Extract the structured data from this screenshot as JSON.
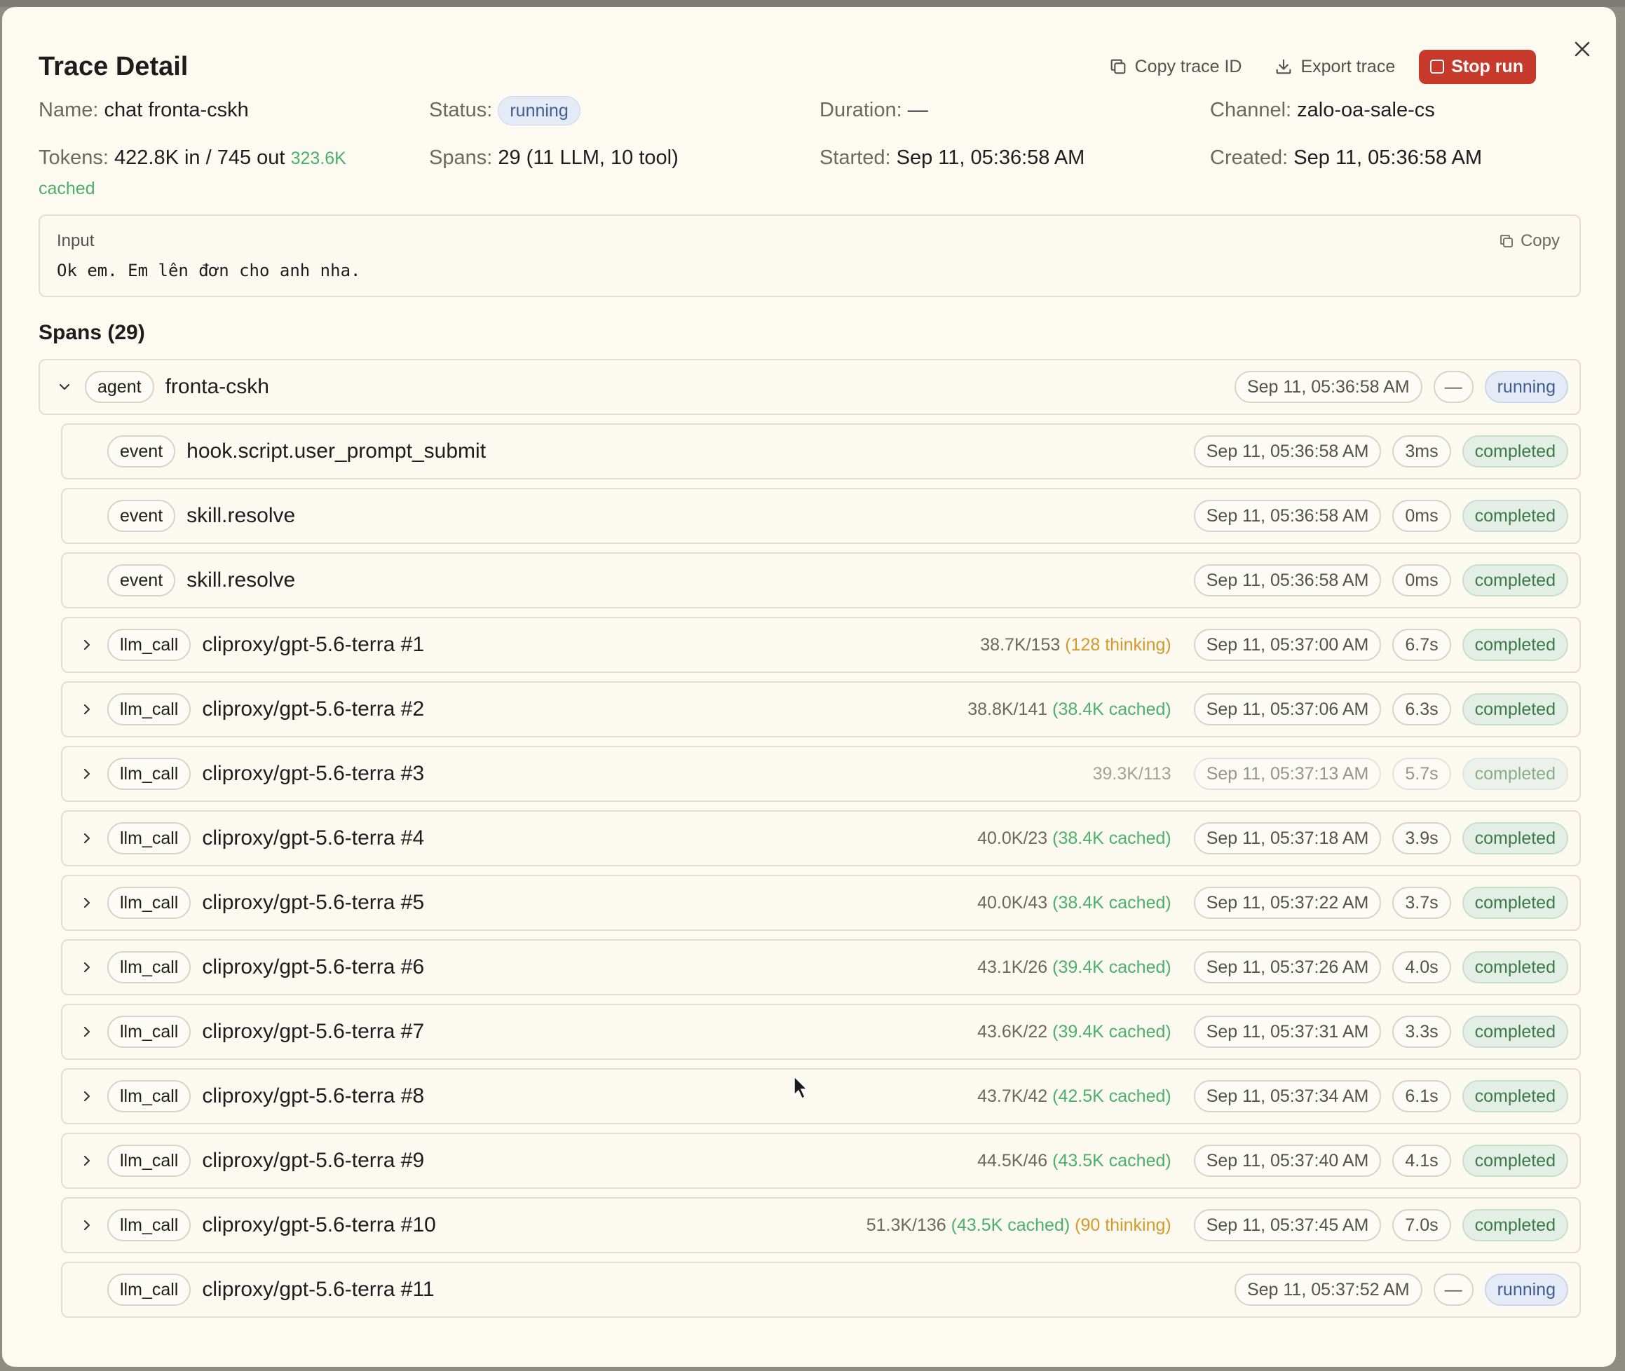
{
  "modal": {
    "title": "Trace Detail",
    "copy_trace_id": "Copy trace ID",
    "export_trace": "Export trace",
    "stop_run": "Stop run"
  },
  "meta": {
    "name_label": "Name:",
    "name_value": "chat fronta-cskh",
    "status_label": "Status:",
    "status_value": "running",
    "duration_label": "Duration:",
    "duration_value": "—",
    "channel_label": "Channel:",
    "channel_value": "zalo-oa-sale-cs",
    "tokens_label": "Tokens:",
    "tokens_value": "422.8K in / 745 out",
    "tokens_cached_num": "323.6K",
    "tokens_cached_word": "cached",
    "spans_label": "Spans:",
    "spans_value": "29 (11 LLM, 10 tool)",
    "started_label": "Started:",
    "started_value": "Sep 11, 05:36:58 AM",
    "created_label": "Created:",
    "created_value": "Sep 11, 05:36:58 AM"
  },
  "input": {
    "label": "Input",
    "text": "Ok em. Em lên đơn cho anh nha.",
    "copy_label": "Copy"
  },
  "spans_title": "Spans (29)",
  "agent_span": {
    "kind": "agent",
    "name": "fronta-cskh",
    "time": "Sep 11, 05:36:58 AM",
    "duration": "—",
    "status": "running"
  },
  "spans": [
    {
      "kind": "event",
      "name": "hook.script.user_prompt_submit",
      "tokens": "",
      "cached": "",
      "thinking": "",
      "time": "Sep 11, 05:36:58 AM",
      "duration": "3ms",
      "status": "completed",
      "expandable": false
    },
    {
      "kind": "event",
      "name": "skill.resolve",
      "tokens": "",
      "cached": "",
      "thinking": "",
      "time": "Sep 11, 05:36:58 AM",
      "duration": "0ms",
      "status": "completed",
      "expandable": false
    },
    {
      "kind": "event",
      "name": "skill.resolve",
      "tokens": "",
      "cached": "",
      "thinking": "",
      "time": "Sep 11, 05:36:58 AM",
      "duration": "0ms",
      "status": "completed",
      "expandable": false
    },
    {
      "kind": "llm_call",
      "name": "cliproxy/gpt-5.6-terra #1",
      "tokens": "38.7K/153",
      "cached": "",
      "thinking": "(128 thinking)",
      "time": "Sep 11, 05:37:00 AM",
      "duration": "6.7s",
      "status": "completed",
      "expandable": true
    },
    {
      "kind": "llm_call",
      "name": "cliproxy/gpt-5.6-terra #2",
      "tokens": "38.8K/141",
      "cached": "(38.4K cached)",
      "thinking": "",
      "time": "Sep 11, 05:37:06 AM",
      "duration": "6.3s",
      "status": "completed",
      "expandable": true
    },
    {
      "kind": "llm_call",
      "name": "cliproxy/gpt-5.6-terra #3",
      "tokens": "39.3K/113",
      "cached": "",
      "thinking": "",
      "time": "Sep 11, 05:37:13 AM",
      "duration": "5.7s",
      "status": "completed",
      "expandable": true,
      "dim": true
    },
    {
      "kind": "llm_call",
      "name": "cliproxy/gpt-5.6-terra #4",
      "tokens": "40.0K/23",
      "cached": "(38.4K cached)",
      "thinking": "",
      "time": "Sep 11, 05:37:18 AM",
      "duration": "3.9s",
      "status": "completed",
      "expandable": true
    },
    {
      "kind": "llm_call",
      "name": "cliproxy/gpt-5.6-terra #5",
      "tokens": "40.0K/43",
      "cached": "(38.4K cached)",
      "thinking": "",
      "time": "Sep 11, 05:37:22 AM",
      "duration": "3.7s",
      "status": "completed",
      "expandable": true
    },
    {
      "kind": "llm_call",
      "name": "cliproxy/gpt-5.6-terra #6",
      "tokens": "43.1K/26",
      "cached": "(39.4K cached)",
      "thinking": "",
      "time": "Sep 11, 05:37:26 AM",
      "duration": "4.0s",
      "status": "completed",
      "expandable": true
    },
    {
      "kind": "llm_call",
      "name": "cliproxy/gpt-5.6-terra #7",
      "tokens": "43.6K/22",
      "cached": "(39.4K cached)",
      "thinking": "",
      "time": "Sep 11, 05:37:31 AM",
      "duration": "3.3s",
      "status": "completed",
      "expandable": true
    },
    {
      "kind": "llm_call",
      "name": "cliproxy/gpt-5.6-terra #8",
      "tokens": "43.7K/42",
      "cached": "(42.5K cached)",
      "thinking": "",
      "time": "Sep 11, 05:37:34 AM",
      "duration": "6.1s",
      "status": "completed",
      "expandable": true
    },
    {
      "kind": "llm_call",
      "name": "cliproxy/gpt-5.6-terra #9",
      "tokens": "44.5K/46",
      "cached": "(43.5K cached)",
      "thinking": "",
      "time": "Sep 11, 05:37:40 AM",
      "duration": "4.1s",
      "status": "completed",
      "expandable": true
    },
    {
      "kind": "llm_call",
      "name": "cliproxy/gpt-5.6-terra #10",
      "tokens": "51.3K/136",
      "cached": "(43.5K cached)",
      "thinking": "(90 thinking)",
      "time": "Sep 11, 05:37:45 AM",
      "duration": "7.0s",
      "status": "completed",
      "expandable": true
    },
    {
      "kind": "llm_call",
      "name": "cliproxy/gpt-5.6-terra #11",
      "tokens": "",
      "cached": "",
      "thinking": "",
      "time": "Sep 11, 05:37:52 AM",
      "duration": "—",
      "status": "running",
      "expandable": false
    }
  ]
}
